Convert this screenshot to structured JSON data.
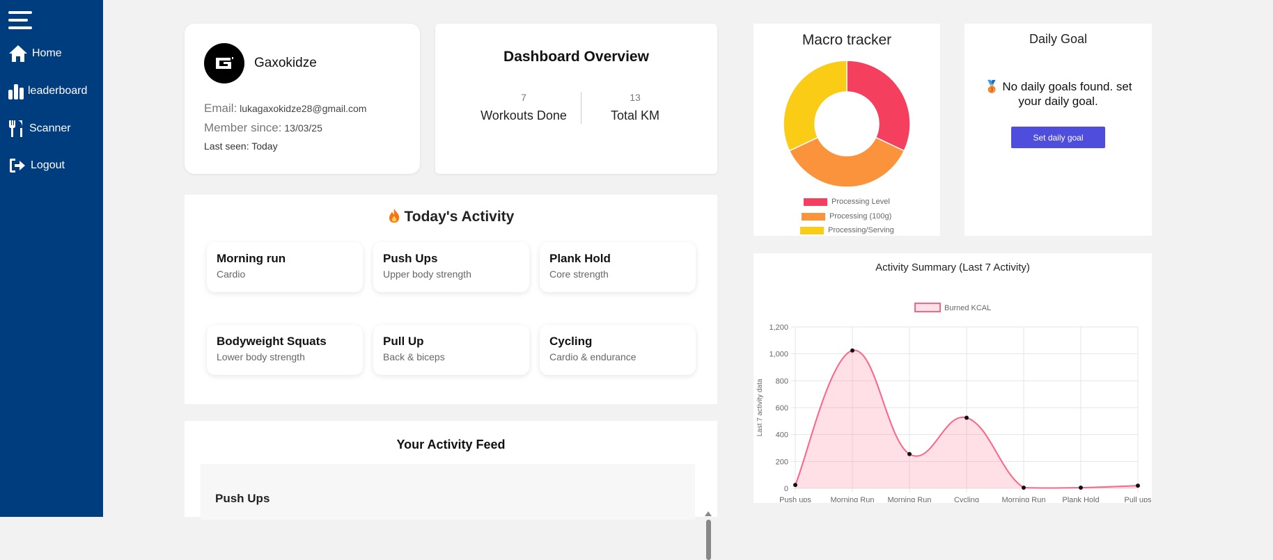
{
  "sidebar": {
    "items": [
      {
        "label": "Home",
        "icon": "home-icon"
      },
      {
        "label": "leaderboard",
        "icon": "bar-chart-icon"
      },
      {
        "label": "Scanner",
        "icon": "fork-knife-icon"
      },
      {
        "label": "Logout",
        "icon": "logout-icon"
      }
    ]
  },
  "profile": {
    "name": "Gaxokidze",
    "email_label": "Email:",
    "email": "lukagaxokidze28@gmail.com",
    "member_label": "Member since:",
    "member_since": "13/03/25",
    "last_seen": "Last seen: Today"
  },
  "overview": {
    "title": "Dashboard Overview",
    "stats": [
      {
        "value": "7",
        "label": "Workouts Done"
      },
      {
        "value": "13",
        "label": "Total KM"
      }
    ]
  },
  "today": {
    "title": "Today's Activity",
    "icon": "fire-icon",
    "activities": [
      {
        "name": "Morning run",
        "type": "Cardio"
      },
      {
        "name": "Push Ups",
        "type": "Upper body strength"
      },
      {
        "name": "Plank Hold",
        "type": "Core strength"
      },
      {
        "name": "Bodyweight Squats",
        "type": "Lower body strength"
      },
      {
        "name": "Pull Up",
        "type": "Back & biceps"
      },
      {
        "name": "Cycling",
        "type": "Cardio & endurance"
      }
    ]
  },
  "feed": {
    "title": "Your Activity Feed",
    "items": [
      "Push Ups"
    ]
  },
  "macro": {
    "title": "Macro tracker",
    "legend": [
      {
        "label": "Processing Level",
        "color": "#f43f5e"
      },
      {
        "label": "Processing (100g)",
        "color": "#fb923c"
      },
      {
        "label": "Processing/Serving",
        "color": "#facc15"
      }
    ]
  },
  "goal": {
    "title": "Daily Goal",
    "message": "🥉 No daily goals found. set your daily goal.",
    "button": "Set daily goal",
    "button_color": "#4f4ddb"
  },
  "colors": {
    "sidebar": "#003d7f",
    "line": "#ff6384",
    "fill": "rgba(255,99,132,0.2)"
  },
  "chart_data": [
    {
      "type": "pie",
      "title": "Macro tracker",
      "categories": [
        "Processing Level",
        "Processing (100g)",
        "Processing/Serving"
      ],
      "values": [
        32,
        36,
        32
      ],
      "colors": [
        "#f43f5e",
        "#fb923c",
        "#facc15"
      ],
      "donut": true,
      "legend": "bottom"
    },
    {
      "type": "area",
      "title": "Activity Summary (Last 7 Activity)",
      "xlabel": "",
      "ylabel": "Last 7 activity data",
      "categories": [
        "Push ups",
        "Morning Run",
        "Morning Run",
        "Cycling",
        "Morning Run",
        "Plank Hold",
        "Pull ups"
      ],
      "series": [
        {
          "name": "Burned KCAL",
          "values": [
            25,
            1025,
            255,
            525,
            5,
            5,
            20
          ]
        }
      ],
      "ylim": [
        0,
        1200
      ],
      "yticks": [
        "0",
        "200",
        "400",
        "600",
        "800",
        "1,000",
        "1,200"
      ],
      "grid": true,
      "legend": "top"
    }
  ]
}
